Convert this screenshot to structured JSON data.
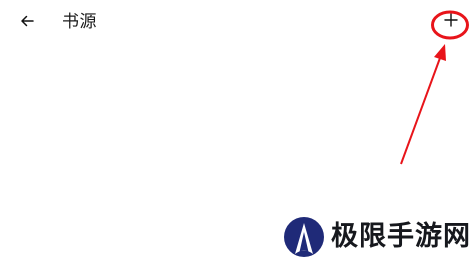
{
  "header": {
    "back_icon": "arrow-left-icon",
    "title": "书源",
    "add_icon": "plus-icon"
  },
  "annotation": {
    "color": "#e8141a",
    "shape": "circle-and-arrow"
  },
  "watermark": {
    "text": "极限手游网",
    "logo_colors": [
      "#1f2a78",
      "#ffffff"
    ]
  }
}
